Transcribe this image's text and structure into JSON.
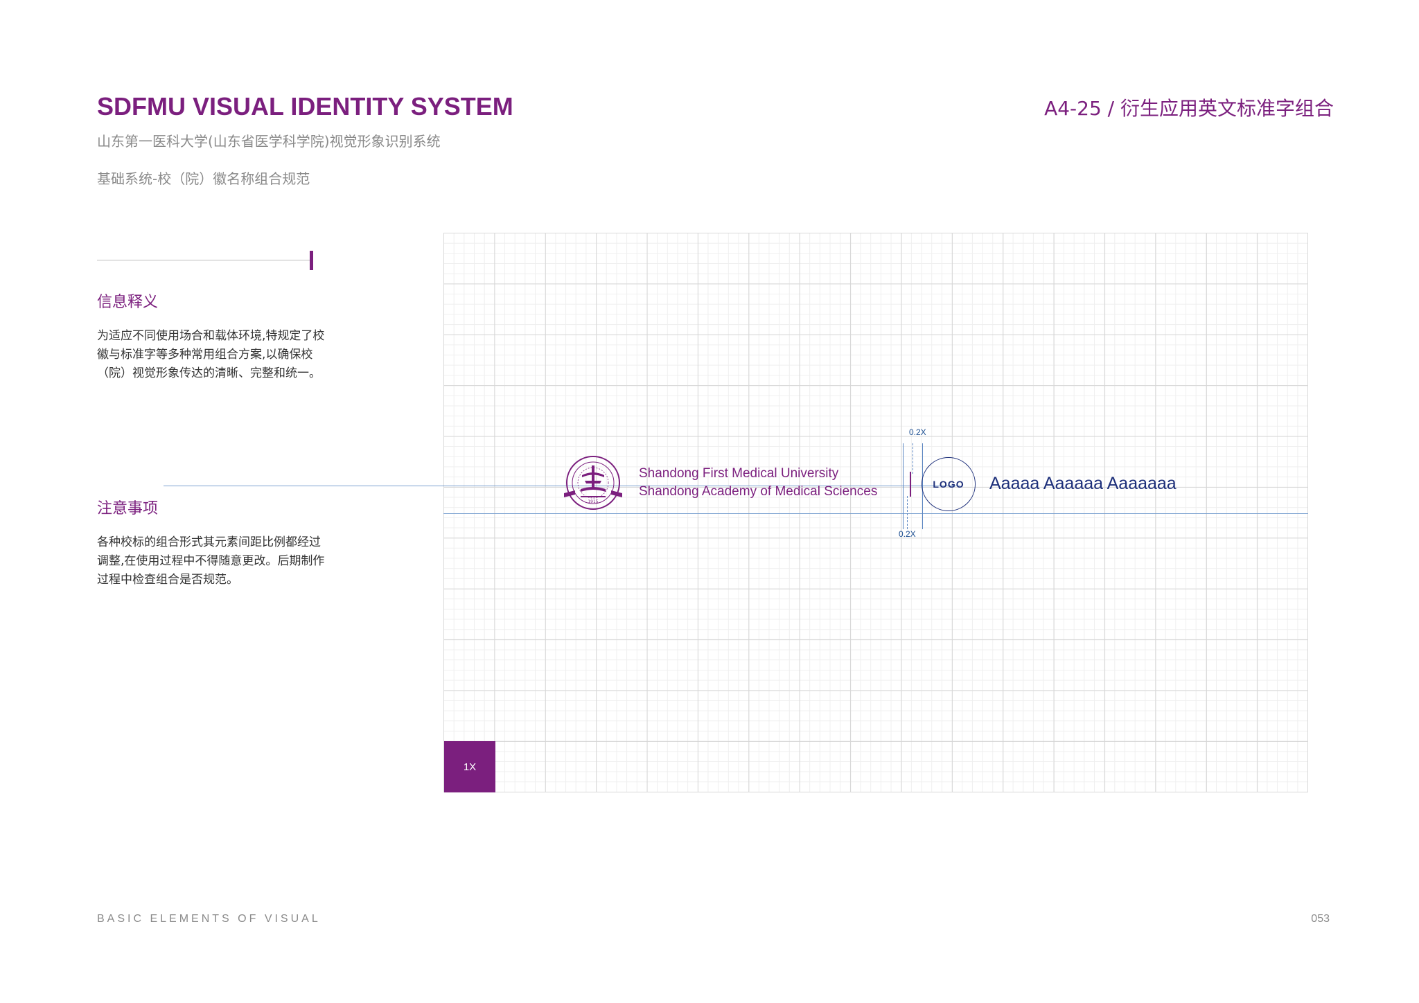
{
  "header": {
    "title": "SDFMU VISUAL IDENTITY SYSTEM",
    "subtitle": "山东第一医科大学(山东省医学科学院)视觉形象识别系统",
    "section": "基础系统-校（院）徽名称组合规范",
    "page_code": "A4-25 /  衍生应用英文标准字组合"
  },
  "sidebar": {
    "info_heading": "信息释义",
    "info_body": "为适应不同使用场合和载体环境,特规定了校徽与标准字等多种常用组合方案,以确保校（院）视觉形象传达的清晰、完整和统一。",
    "note_heading": "注意事项",
    "note_body": "各种校标的组合形式其元素间距比例都经过调整,在使用过程中不得随意更改。后期制作过程中检查组合是否规范。"
  },
  "diagram": {
    "unit_label": "1X",
    "spacing_label_top": "0.2X",
    "spacing_label_bottom": "0.2X",
    "name_line1": "Shandong First Medical University",
    "name_line2": "Shandong Academy of Medical Sciences",
    "emblem_year": "1915",
    "logo_label": "LOGO",
    "placeholder_text": "Aaaaa Aaaaaa Aaaaaaa"
  },
  "footer": {
    "left": "BASIC ELEMENTS OF VISUAL",
    "page_number": "053"
  },
  "colors": {
    "brand_purple": "#7b1f7e",
    "logo_navy": "#1d2f7a",
    "guide_blue": "#7aa0d0"
  }
}
